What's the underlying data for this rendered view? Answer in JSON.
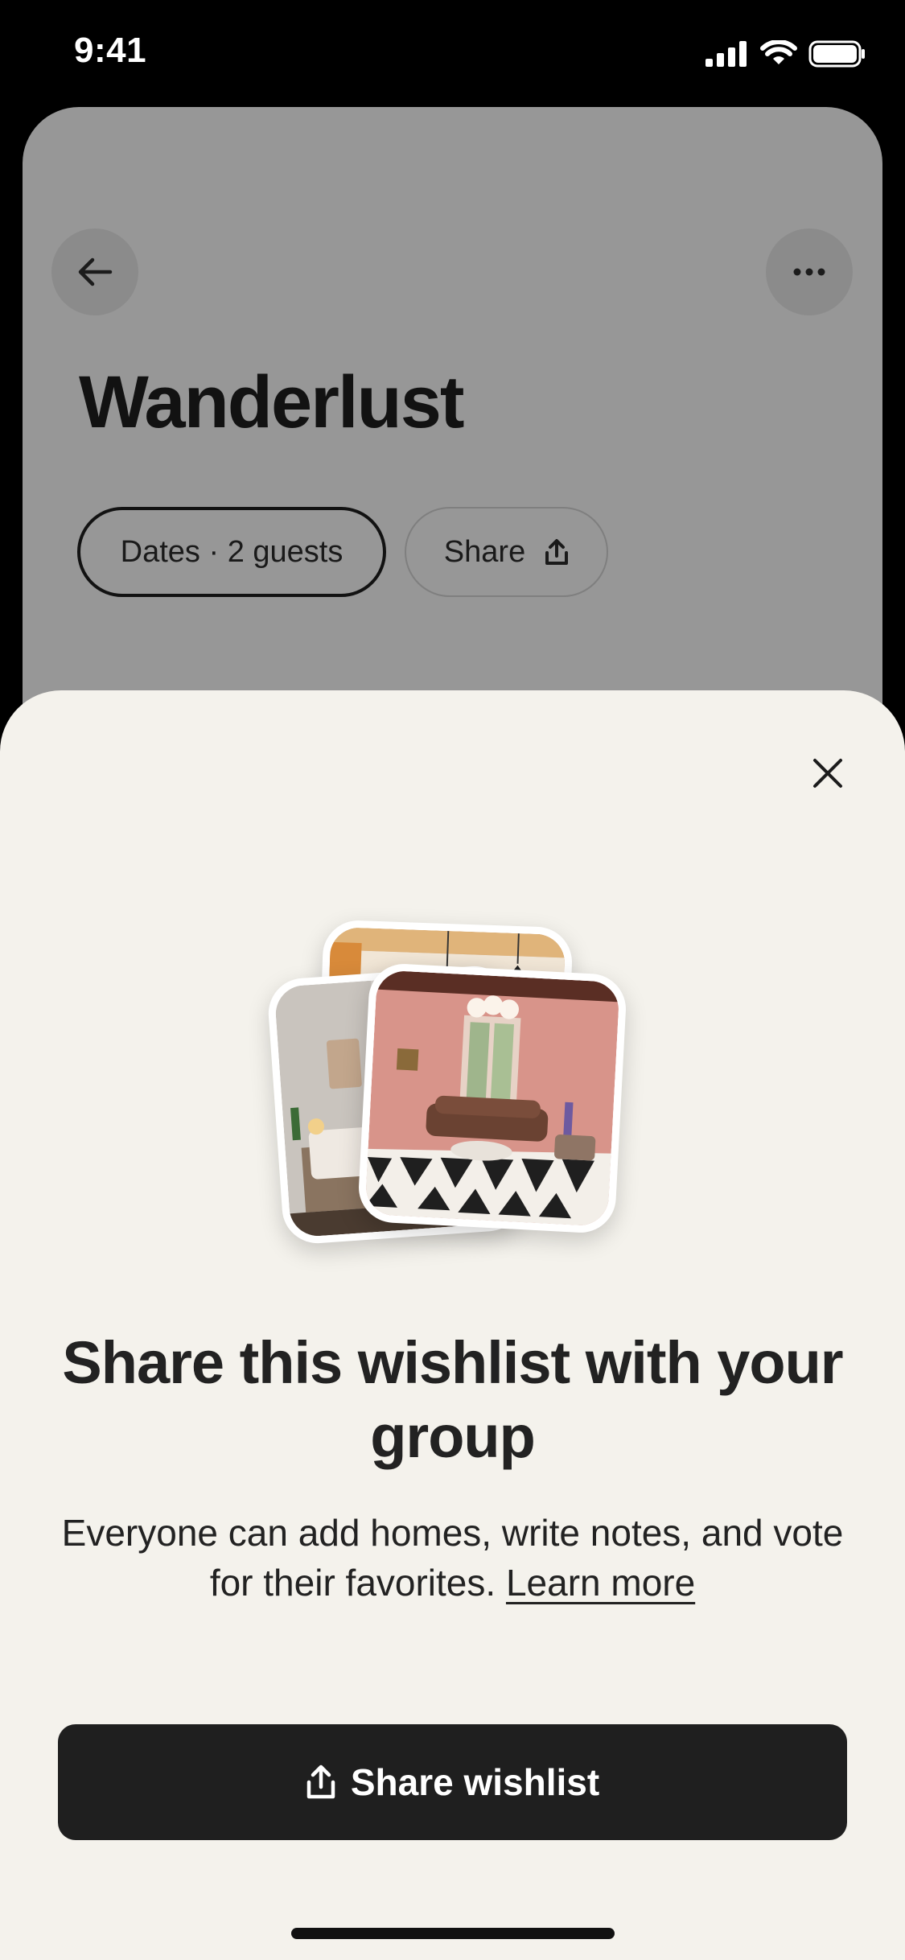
{
  "status_bar": {
    "time": "9:41",
    "icons": [
      "cellular-signal-icon",
      "wifi-icon",
      "battery-icon"
    ]
  },
  "background_page": {
    "title": "Wanderlust",
    "back_icon": "arrow-left-icon",
    "more_icon": "more-horizontal-icon",
    "filters": {
      "dates_label": "Dates · 2 guests",
      "share_label": "Share",
      "share_icon": "share-upload-icon"
    }
  },
  "share_sheet": {
    "close_icon": "close-icon",
    "images": [
      "listing-photo-kitchen",
      "listing-photo-bedroom",
      "listing-photo-living-room"
    ],
    "title": "Share this wishlist with your group",
    "description": "Everyone can add homes, write notes, and vote for their favorites.",
    "learn_more_label": "Learn more",
    "share_button_label": "Share wishlist",
    "share_button_icon": "share-upload-icon"
  },
  "colors": {
    "sheet_background": "#f4f2ec",
    "dimmed_page": "#979797",
    "primary_button": "#1f1f1f",
    "text_primary": "#222222"
  }
}
